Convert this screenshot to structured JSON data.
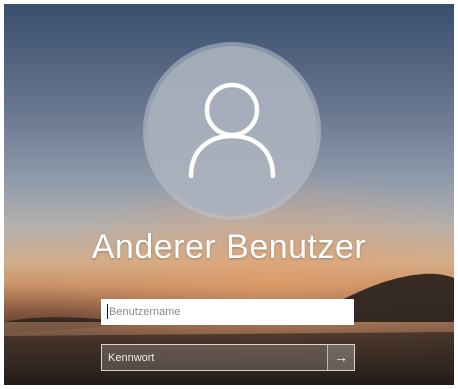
{
  "login": {
    "user_name": "Anderer Benutzer",
    "avatar_icon": "user-icon",
    "username_placeholder": "Benutzername",
    "username_value": "",
    "password_placeholder": "Kennwort",
    "password_value": "",
    "submit_icon": "arrow-right-icon",
    "submit_glyph": "→"
  },
  "colors": {
    "sky_top": "#3a4f6e",
    "horizon_glow": "#d2ad8a",
    "avatar_circle": "#aab2be",
    "text": "#ffffff"
  }
}
